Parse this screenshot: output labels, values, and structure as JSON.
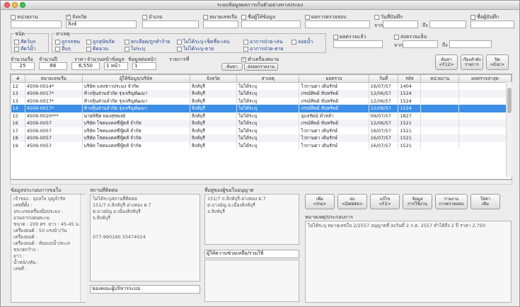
{
  "window": {
    "title": "ระบบข้อมูลผลการเก็บตัวอย่างทางประมง"
  },
  "filters": {
    "row1": [
      {
        "label": "หน่วยงาน",
        "checked": false
      },
      {
        "label": "จังหวัด",
        "checked": true
      },
      {
        "label": "อำเภอ",
        "checked": false
      },
      {
        "label": "หมายเลขเรือ",
        "checked": false
      },
      {
        "label": "ชื่อผู้ให้ข้อมูล",
        "checked": false
      },
      {
        "label": "ผลการตรวจสอบ",
        "checked": false
      },
      {
        "label": "วันที่บันทึก",
        "checked": false
      },
      {
        "label": "ชื่อผู้บันทึก",
        "checked": false
      }
    ],
    "province_value": "สิงห์",
    "date_from_label": "จาก",
    "date_to_label": "ถึง"
  },
  "group_type": {
    "title": "ชนิด",
    "options": [
      "สัตว์บก",
      "สัตว์น้ำ"
    ]
  },
  "group_category": {
    "title": "สาเหตุ",
    "options_row1": [
      "ถูกรถชน",
      "ถูกสุนัขกัด",
      "ตกเลือด/ถูกทำร้าย",
      "ไม่ได้ระบุ-เช็คชื่อ-เล่น",
      "อาการป่วย-เล่น",
      "ลอยน้ำ"
    ],
    "options_row2": [
      "อื่นๆ",
      "ติดอวน",
      "ไม่ระบุ",
      "ไม่ได้ระบุ-ตาย",
      "อาการป่วย-ตาย"
    ]
  },
  "group_extra": {
    "check1": "ผลตรวจแล้ว",
    "check2": "ส่งตรวจแล็บ",
    "from_label": "จาก",
    "to_label": "ถึง"
  },
  "summary": {
    "labels": [
      "จำนวนเรือ",
      "จำนวนปี",
      "ราคา",
      "จำนวนหน้าข้อมูล",
      "ข้อมูลต่อหน้า",
      "รายการที่"
    ],
    "values": [
      "25",
      "66",
      "6,550",
      "1 หน้า",
      "1"
    ],
    "check_label": "ทำเครื่องหมาย",
    "btn_search": "ค้นหา",
    "btn_export": "ส่งออกรายงาน"
  },
  "right_buttons": [
    {
      "label": "ค้นหา\n<F12>"
    },
    {
      "label": "เรียงลำดับ\nรายการ"
    },
    {
      "label": "ปิด\n<Esc>"
    }
  ],
  "table": {
    "columns": [
      "#",
      "หมายเลขเรือ",
      "ผู้ให้ข้อมูล/บริษัท",
      "จังหวัด",
      "สาเหตุ",
      "ผลตรวจ",
      "วันที่",
      "รหัส",
      "หน่วยงาน",
      "ผลตรวจล่าสุด"
    ],
    "rows": [
      [
        "12",
        "4509-0014*",
        "บริษัท แสงชาวประมง จำกัด",
        "สิงห์บุรี",
        "ไม่ได้ระบุ",
        "ไวกานดา เดินรักษ์",
        "16/07/57",
        "1404",
        "",
        ""
      ],
      [
        "13",
        "4509-0017*",
        "ห้างหุ้นส่วนจำกัด รุ่งเจริญพัฒนา",
        "สิงห์บุรี",
        "ไม่ได้ระบุ",
        "ภรณ์ทิพย์ ทับทรัพย์",
        "12/06/57",
        "1524",
        "",
        ""
      ],
      [
        "13",
        "4509-0017*",
        "ห้างหุ้นส่วนจำกัด รุ่งเจริญพัฒนา",
        "สิงห์บุรี",
        "ไม่ได้ระบุ",
        "ภรณ์ทิพย์ ทับทรัพย์",
        "12/06/57",
        "1524",
        "",
        ""
      ],
      [
        "14",
        "4509-0017*",
        "ห้างหุ้นส่วนจำกัด รุ่งเจริญพัฒนา",
        "สิงห์บุรี",
        "ไม่ได้ระบุ",
        "ภรณ์ทิพย์ ทับทรัพย์",
        "12/06/57",
        "1524",
        "",
        ""
      ],
      [
        "15",
        "4509-0020***",
        "นายพิชิต ทองสุขพงษ์",
        "สิงห์บุรี",
        "ไม่ได้ระบุ",
        "อุบลรัตน์ คำหล้า",
        "09/07/57",
        "1827",
        "",
        ""
      ],
      [
        "16",
        "4509-0057",
        "บริษัท โชคมงคลซีฟู้ดส์ จำกัด",
        "สิงห์บุรี",
        "ไม่ได้ระบุ",
        "ภรณ์ทิพย์ ทับทรัพย์",
        "12/06/57",
        "1521",
        "",
        ""
      ],
      [
        "17",
        "4509-0057",
        "บริษัท โชคมงคลซีฟู้ดส์ จำกัด",
        "สิงห์บุรี",
        "ไม่ได้ระบุ",
        "ไวกานดา เดินรักษ์",
        "16/07/57",
        "1521",
        "",
        ""
      ],
      [
        "18",
        "4509-0057",
        "บริษัท โชคมงคลซีฟู้ดส์ จำกัด",
        "สิงห์บุรี",
        "ไม่ได้ระบุ",
        "ไวกานดา เดินรักษ์",
        "16/07/57",
        "1521",
        "",
        ""
      ],
      [
        "19",
        "4509-0057",
        "บริษัท โชคมงคลซีฟู้ดส์ จำกัด",
        "สิงห์บุรี",
        "ไม่ได้ระบุ",
        "ไวกานดา เดินรักษ์",
        "16/07/57",
        "1521",
        "",
        ""
      ]
    ],
    "selected_index": 3
  },
  "detail": {
    "info_title": "ข้อมูลประกอบการขอใบ",
    "info_text": "เจ้าของ : อุบลใจ บุญจำรัส\nเลขที่ตั้ง :\nประเภทเครื่องมือประมง :\nอวนลากแผ่นตะเฆ่\nขนาด : 200 ตร. ยาว : 45-45 ม.\nเครื่องยนต์ : 50 แรงม้า/วัน\nเครื่องยนต์ :\nเครื่องยนต์ : ท้องแม่น้ำ/ทะเล\nขนาดกว้าง :\nยาว :\nน้ำหนัก/ตัน :\nเลขที่ :",
    "addr_title": "สถานที่ติดต่อ",
    "addr_text": "ไม่ได้ระบุสถานที่ติดต่อ\n151/7 ถ.สิงห์บุรี-อ่างทอง ต.7\nต.บางมัญ อ.เมืองสิงห์บุรี\nจ.สิงห์บุรี\n\n\n077-990190 33474024",
    "addr_footer": "ของคณะผู้บริหารระบบ",
    "boat_title": "ที่อยู่ของผู้ขอใบอนุญาต",
    "boat_text": "151/7 ถ.สิงห์บุรี-อ่างทอง ต.7\nต.บางมัญ อ.เมืองสิงห์บุรี\nจ.สิงห์บุรี",
    "boat_field_label": "ผู้ให้ความช่วยเหลือ/ร่วมใช้",
    "note_title": "หมายเหตุ/ประกอบการ",
    "note_text": "ไม่ได้ระบุ หมายเลขใบ 2/2557 อนุญาตที่ ลงวันที่ 2 ก.ค. 2557 ทำได้ถึง 2 ปี ราคา 2,750"
  },
  "action_buttons": [
    {
      "label": "เพิ่ม\n<Ins>"
    },
    {
      "label": "ลบ\n<Delete>"
    },
    {
      "label": "แก้ไข\n<F2>"
    },
    {
      "label": "ข้อมูล\nการใช้งาน"
    },
    {
      "label": "รายงาน\nการตรวจสอบ"
    },
    {
      "label": "ใส่ค่า\nเดิม"
    }
  ]
}
